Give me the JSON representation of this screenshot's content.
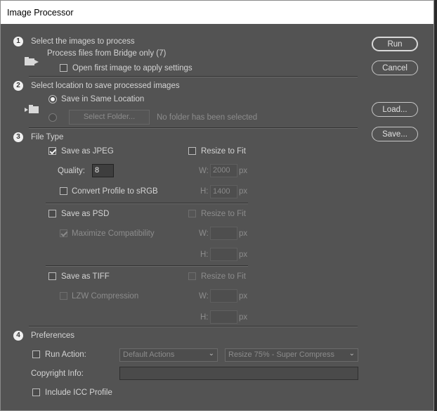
{
  "window": {
    "title": "Image Processor"
  },
  "buttons": {
    "run": "Run",
    "cancel": "Cancel",
    "load": "Load...",
    "save": "Save..."
  },
  "section1": {
    "number": "1",
    "title": "Select the images to process",
    "source_text": "Process files from Bridge only (7)",
    "open_first_label": "Open first image to apply settings",
    "open_first_checked": false
  },
  "section2": {
    "number": "2",
    "title": "Select location to save processed images",
    "same_location_label": "Save in Same Location",
    "select_folder_label": "Select Folder...",
    "no_folder_text": "No folder has been selected"
  },
  "section3": {
    "number": "3",
    "title": "File Type",
    "jpeg": {
      "save_label": "Save as JPEG",
      "checked": true,
      "resize_label": "Resize to Fit",
      "quality_label": "Quality:",
      "quality_value": "8",
      "w_label": "W:",
      "w_value": "2000",
      "w_unit": "px",
      "h_label": "H:",
      "h_value": "1400",
      "h_unit": "px",
      "convert_label": "Convert Profile to sRGB"
    },
    "psd": {
      "save_label": "Save as PSD",
      "resize_label": "Resize to Fit",
      "maximize_label": "Maximize Compatibility",
      "w_label": "W:",
      "w_unit": "px",
      "h_label": "H:",
      "h_unit": "px"
    },
    "tiff": {
      "save_label": "Save as TIFF",
      "resize_label": "Resize to Fit",
      "lzw_label": "LZW Compression",
      "w_label": "W:",
      "w_unit": "px",
      "h_label": "H:",
      "h_unit": "px"
    }
  },
  "section4": {
    "number": "4",
    "title": "Preferences",
    "run_action_label": "Run Action:",
    "action_set": "Default Actions",
    "action": "Resize 75% - Super Compress",
    "copyright_label": "Copyright Info:",
    "copyright_value": "",
    "icc_label": "Include ICC Profile"
  }
}
